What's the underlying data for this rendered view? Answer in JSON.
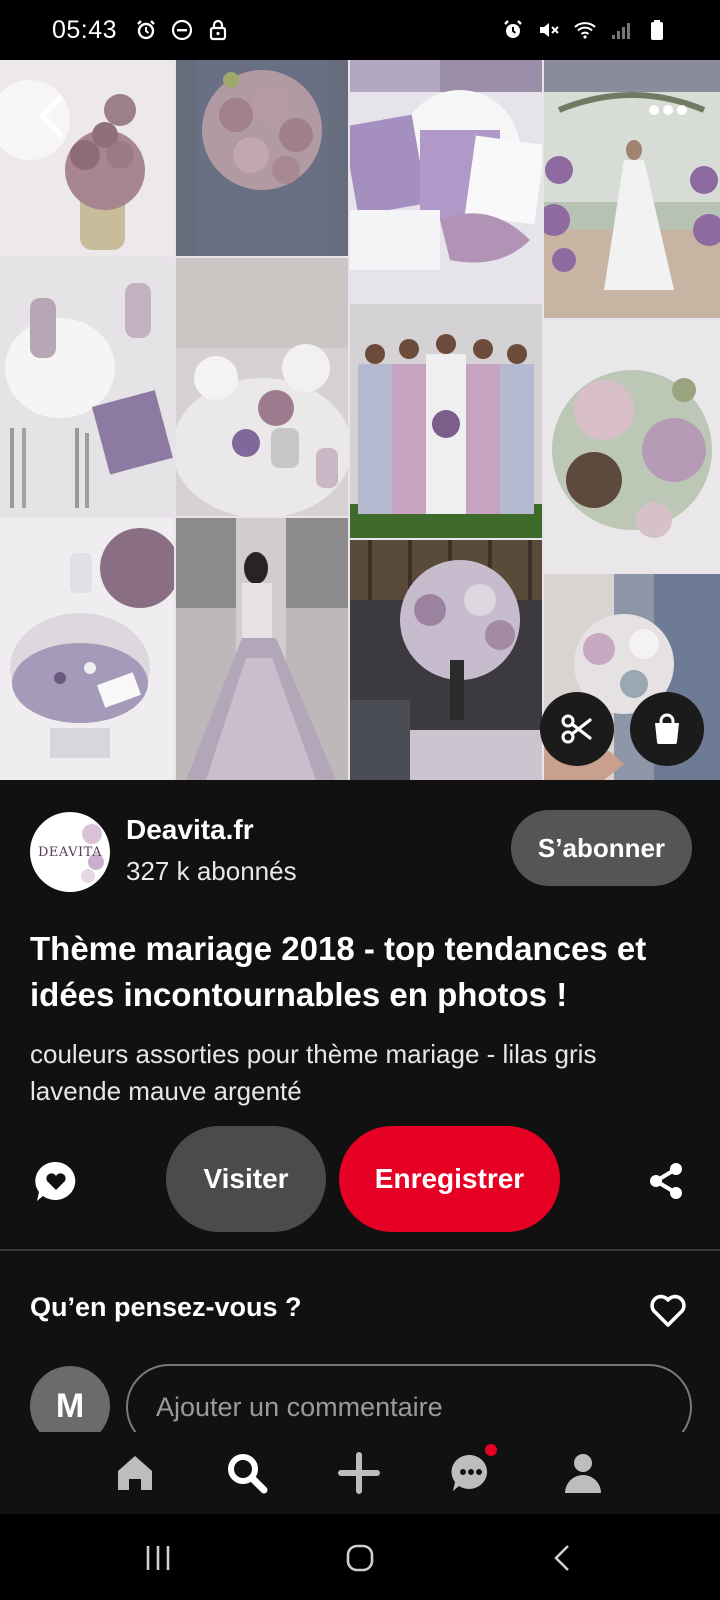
{
  "status_bar": {
    "time": "05:43",
    "left_icons": [
      "alarm-icon",
      "do-not-disturb-icon",
      "lock-icon"
    ],
    "right_icons": [
      "alarm-icon",
      "mute-icon",
      "wifi-icon",
      "signal-icon",
      "battery-icon"
    ]
  },
  "pin": {
    "image_tiles": [
      "lilac-roses-vase",
      "bridesmaid-bouquet",
      "purple-invitations",
      "floral-arch-bride",
      "lavender-table-setting",
      "centerpieces",
      "bridesmaids-floral-dresses",
      "rose-artichoke-bouquet",
      "candy-jar",
      "tulle-gown",
      "reception-hall",
      "groom-bouquet"
    ],
    "creator": {
      "avatar_text": "DEAVITA",
      "name": "Deavita.fr",
      "followers": "327 k abonnés",
      "follow_label": "S’abonner"
    },
    "title": "Thème mariage 2018 - top tendances et idées incontournables en photos !",
    "description": "couleurs assorties pour thème mariage - lilas gris lavende mauve argenté"
  },
  "actions": {
    "visit_label": "Visiter",
    "save_label": "Enregistrer"
  },
  "feedback": {
    "title": "Qu’en pensez-vous ?"
  },
  "comment": {
    "user_initial": "M",
    "placeholder": "Ajouter un commentaire"
  },
  "bottom_nav": {
    "items": [
      "home-icon",
      "search-icon",
      "create-icon",
      "messages-icon",
      "profile-icon"
    ]
  },
  "colors": {
    "background": "#111111",
    "save_red": "#e60023",
    "visit_gray": "#4b4b4b",
    "follow_gray": "#555555"
  }
}
